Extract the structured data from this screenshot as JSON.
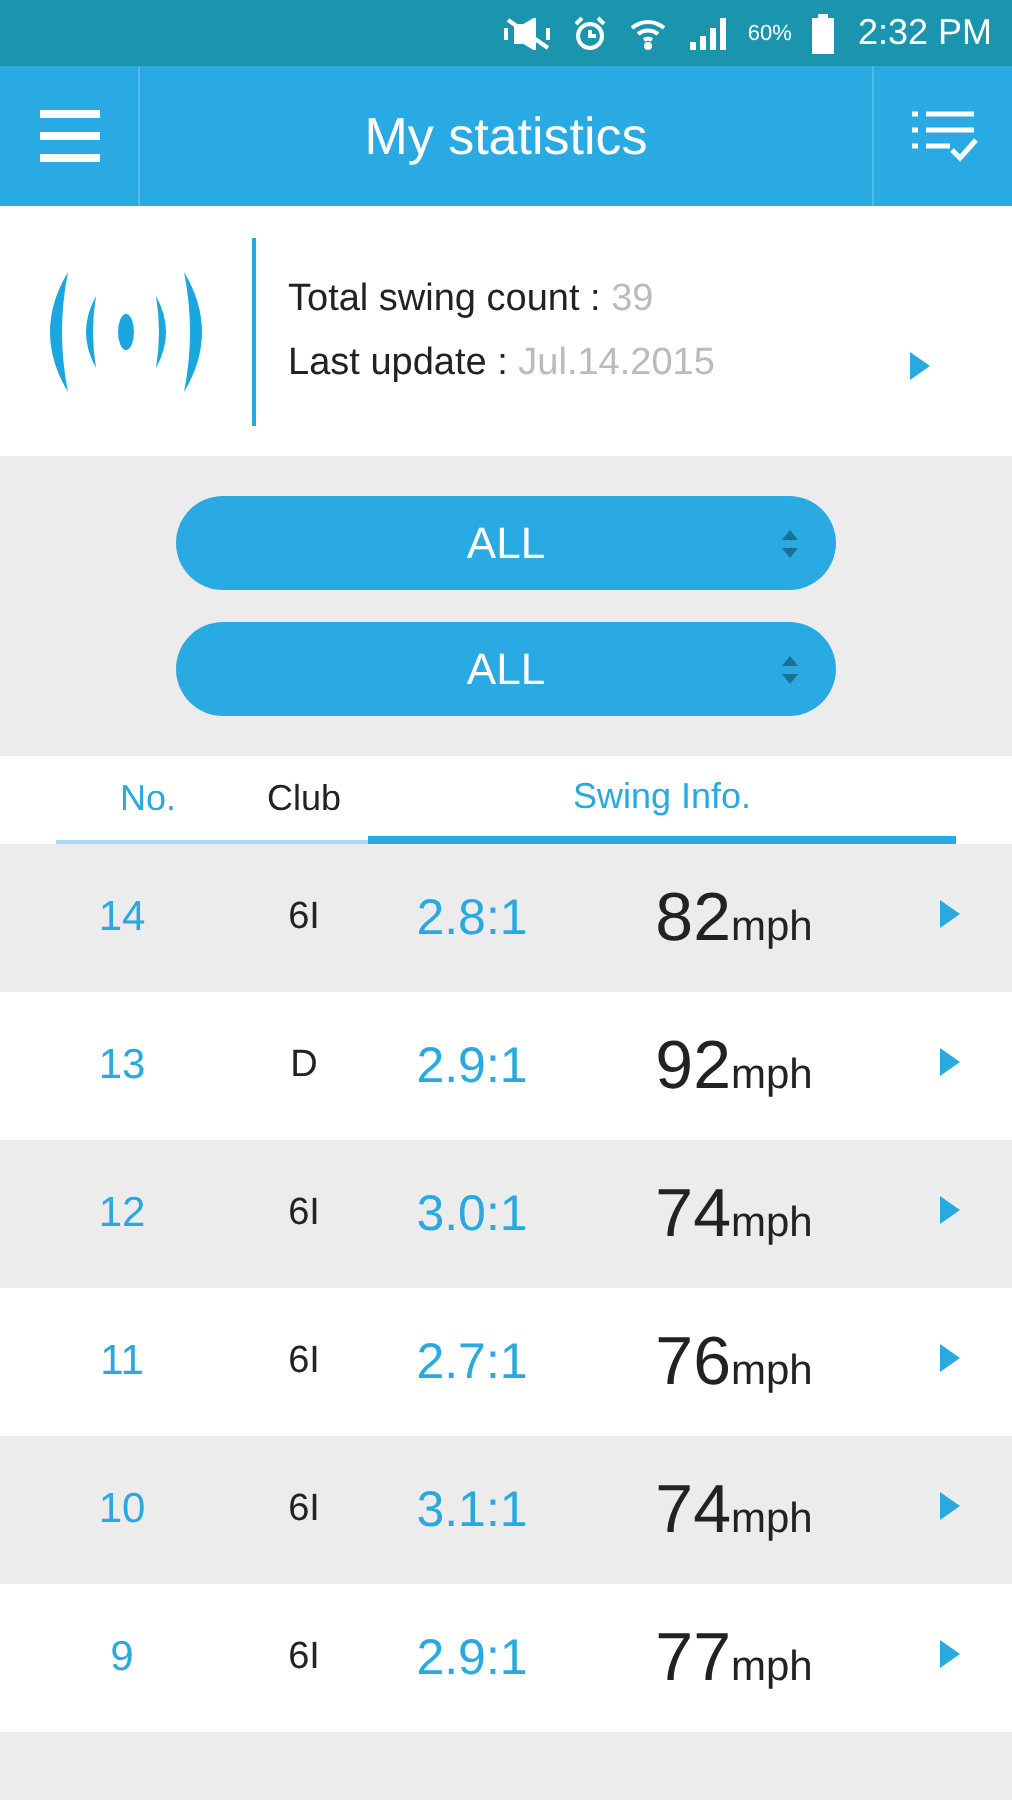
{
  "status_bar": {
    "battery": "60%",
    "time": "2:32 PM"
  },
  "header": {
    "title": "My statistics"
  },
  "summary": {
    "count_label": "Total swing count :",
    "count": "39",
    "update_label": "Last update :",
    "update": "Jul.14.2015"
  },
  "filters": [
    {
      "value": "ALL"
    },
    {
      "value": "ALL"
    }
  ],
  "table": {
    "columns": [
      {
        "label": "No.",
        "selected": false,
        "color": "#29a9e0"
      },
      {
        "label": "Club",
        "selected": false,
        "color": "#222222"
      },
      {
        "label": "Swing Info.",
        "selected": true,
        "color": "#29a9e0"
      }
    ],
    "rows": [
      {
        "no": "14",
        "club": "6I",
        "ratio": "2.8:1",
        "speed": "82",
        "unit": "mph"
      },
      {
        "no": "13",
        "club": "D",
        "ratio": "2.9:1",
        "speed": "92",
        "unit": "mph"
      },
      {
        "no": "12",
        "club": "6I",
        "ratio": "3.0:1",
        "speed": "74",
        "unit": "mph"
      },
      {
        "no": "11",
        "club": "6I",
        "ratio": "2.7:1",
        "speed": "76",
        "unit": "mph"
      },
      {
        "no": "10",
        "club": "6I",
        "ratio": "3.1:1",
        "speed": "74",
        "unit": "mph"
      },
      {
        "no": "9",
        "club": "6I",
        "ratio": "2.9:1",
        "speed": "77",
        "unit": "mph"
      }
    ]
  }
}
